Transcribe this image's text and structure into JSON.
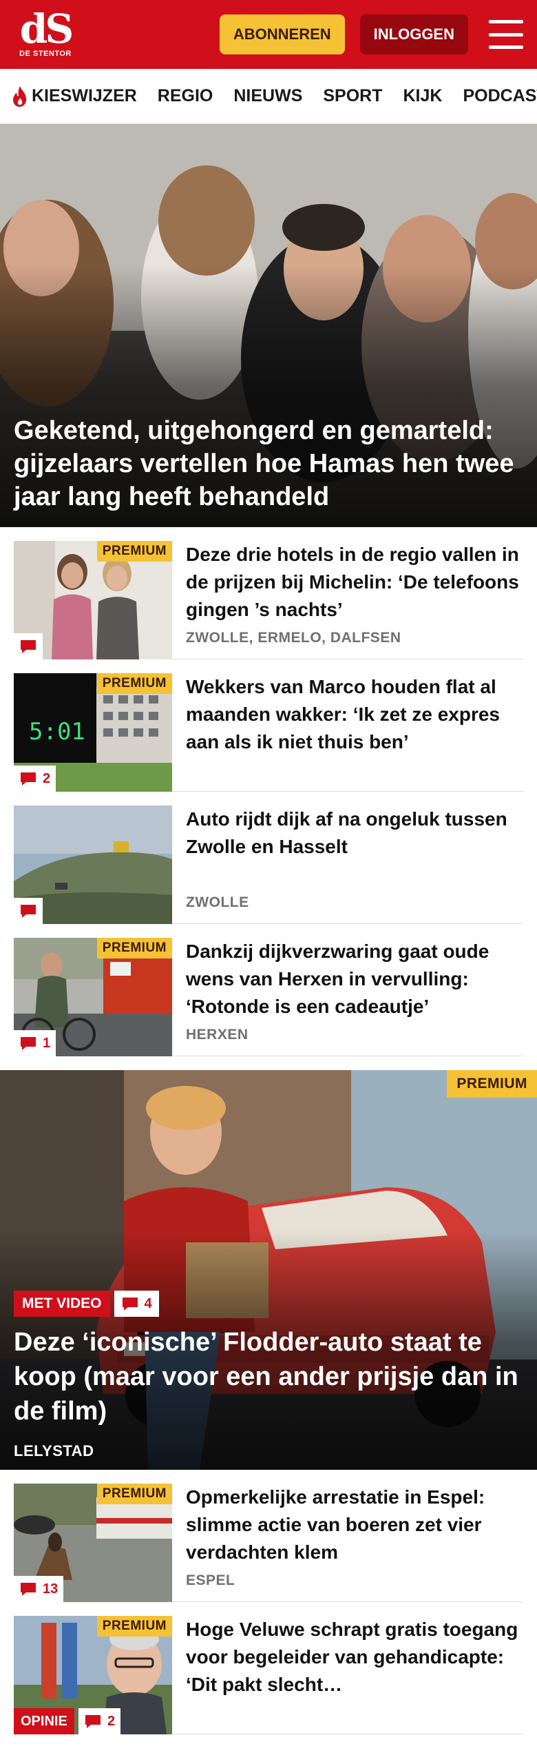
{
  "header": {
    "logo_text": "dS",
    "logo_sub": "DE STENTOR",
    "subscribe_label": "ABONNEREN",
    "login_label": "INLOGGEN"
  },
  "nav": {
    "items": [
      "KIESWIJZER",
      "REGIO",
      "NIEUWS",
      "SPORT",
      "KIJK",
      "PODCASTS"
    ]
  },
  "hero": {
    "title": "Geketend, uitgehongerd en gemarteld: gijzelaars vertellen hoe Hamas hen twee jaar lang heeft behandeld"
  },
  "list1": [
    {
      "title": "Deze drie hotels in de regio vallen in de prijzen bij Michelin: ‘De telefoons gingen ’s nachts’",
      "place": "ZWOLLE, ERMELO, DALFSEN",
      "premium": "PREMIUM",
      "comments": ""
    },
    {
      "title": "Wekkers van Marco houden flat al maanden wakker: ‘Ik zet ze expres aan als ik niet thuis ben’",
      "place": "",
      "premium": "PREMIUM",
      "comments": "2"
    },
    {
      "title": "Auto rijdt dijk af na ongeluk tussen Zwolle en Hasselt",
      "place": "ZWOLLE",
      "premium": "",
      "comments": ""
    },
    {
      "title": "Dankzij dijkverzwaring gaat oude wens van Herxen in vervulling: ‘Rotonde is een cadeautje’",
      "place": "HERXEN",
      "premium": "PREMIUM",
      "comments": "1"
    }
  ],
  "feature": {
    "premium": "PREMIUM",
    "video_label": "MET VIDEO",
    "comments": "4",
    "title": "Deze ‘iconische’ Flodder-auto staat te koop (maar voor een ander prijsje dan in de film)",
    "place": "LELYSTAD"
  },
  "list2": [
    {
      "title": "Opmerkelijke arrestatie in Espel: slimme actie van boeren zet vier verdachten klem",
      "place": "ESPEL",
      "premium": "PREMIUM",
      "comments": "13"
    },
    {
      "title": "Hoge Veluwe schrapt gratis toegang voor begeleider van gehandicapte: ‘Dit pakt slecht…",
      "place": "",
      "premium": "PREMIUM",
      "comments": "2",
      "opinion": "OPINIE"
    }
  ],
  "colors": {
    "brand_red": "#d00f1b",
    "premium_yellow": "#f5c235",
    "login_dark_red": "#97070f"
  }
}
